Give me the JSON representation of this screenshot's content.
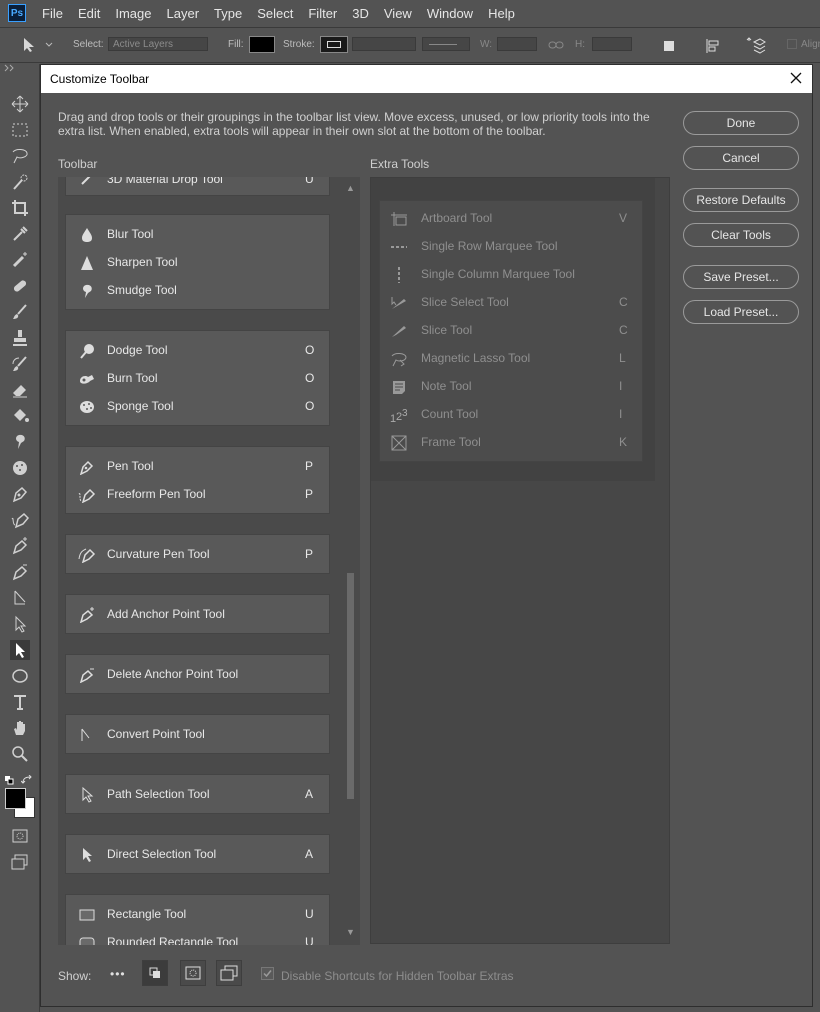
{
  "app": {
    "logo": "Ps"
  },
  "menu": [
    "File",
    "Edit",
    "Image",
    "Layer",
    "Type",
    "Select",
    "Filter",
    "3D",
    "View",
    "Window",
    "Help"
  ],
  "options_bar": {
    "select_label": "Select:",
    "select_value": "Active Layers",
    "fill_label": "Fill:",
    "stroke_label": "Stroke:",
    "w_label": "W:",
    "h_label": "H:",
    "align_label": "Align"
  },
  "dialog": {
    "title": "Customize Toolbar",
    "description": "Drag and drop tools or their groupings in the toolbar list view. Move excess, unused, or low priority tools into the extra list. When enabled, extra tools will appear in their own slot at the bottom of the toolbar.",
    "toolbar_label": "Toolbar",
    "extra_label": "Extra Tools",
    "partial_top_name": "3D Material Drop Tool",
    "partial_top_key": "U",
    "toolbar_groups": [
      {
        "tools": [
          {
            "name": "Blur Tool",
            "key": "",
            "icon": "blur-icon"
          },
          {
            "name": "Sharpen Tool",
            "key": "",
            "icon": "sharpen-icon"
          },
          {
            "name": "Smudge Tool",
            "key": "",
            "icon": "smudge-icon"
          }
        ]
      },
      {
        "tools": [
          {
            "name": "Dodge Tool",
            "key": "O",
            "icon": "dodge-icon"
          },
          {
            "name": "Burn Tool",
            "key": "O",
            "icon": "burn-icon"
          },
          {
            "name": "Sponge Tool",
            "key": "O",
            "icon": "sponge-icon"
          }
        ]
      },
      {
        "tools": [
          {
            "name": "Pen Tool",
            "key": "P",
            "icon": "pen-icon"
          },
          {
            "name": "Freeform Pen Tool",
            "key": "P",
            "icon": "freeform-pen-icon"
          }
        ]
      },
      {
        "tools": [
          {
            "name": "Curvature Pen Tool",
            "key": "P",
            "icon": "curvature-pen-icon"
          }
        ]
      },
      {
        "tools": [
          {
            "name": "Add Anchor Point Tool",
            "key": "",
            "icon": "add-anchor-icon"
          }
        ]
      },
      {
        "tools": [
          {
            "name": "Delete Anchor Point Tool",
            "key": "",
            "icon": "delete-anchor-icon"
          }
        ]
      },
      {
        "tools": [
          {
            "name": "Convert Point Tool",
            "key": "",
            "icon": "convert-point-icon"
          }
        ]
      },
      {
        "tools": [
          {
            "name": "Path Selection Tool",
            "key": "A",
            "icon": "path-selection-icon"
          }
        ]
      },
      {
        "tools": [
          {
            "name": "Direct Selection Tool",
            "key": "A",
            "icon": "direct-selection-icon"
          }
        ]
      },
      {
        "tools": [
          {
            "name": "Rectangle Tool",
            "key": "U",
            "icon": "rectangle-icon"
          },
          {
            "name": "Rounded Rectangle Tool",
            "key": "U",
            "icon": "rounded-rectangle-icon"
          }
        ]
      }
    ],
    "extra_tools": [
      {
        "name": "Artboard Tool",
        "key": "V",
        "icon": "artboard-icon"
      },
      {
        "name": "Single Row Marquee Tool",
        "key": "",
        "icon": "single-row-marquee-icon"
      },
      {
        "name": "Single Column Marquee Tool",
        "key": "",
        "icon": "single-column-marquee-icon"
      },
      {
        "name": "Slice Select Tool",
        "key": "C",
        "icon": "slice-select-icon"
      },
      {
        "name": "Slice Tool",
        "key": "C",
        "icon": "slice-icon"
      },
      {
        "name": "Magnetic Lasso Tool",
        "key": "L",
        "icon": "magnetic-lasso-icon"
      },
      {
        "name": "Note Tool",
        "key": "I",
        "icon": "note-icon"
      },
      {
        "name": "Count Tool",
        "key": "I",
        "icon": "count-icon"
      },
      {
        "name": "Frame Tool",
        "key": "K",
        "icon": "frame-icon"
      }
    ],
    "buttons": {
      "done": "Done",
      "cancel": "Cancel",
      "restore": "Restore Defaults",
      "clear": "Clear Tools",
      "save": "Save Preset...",
      "load": "Load Preset..."
    },
    "footer": {
      "show_label": "Show:",
      "ellipsis": "•••",
      "checkbox_label": "Disable Shortcuts for Hidden Toolbar Extras",
      "checkbox_checked": true
    }
  }
}
